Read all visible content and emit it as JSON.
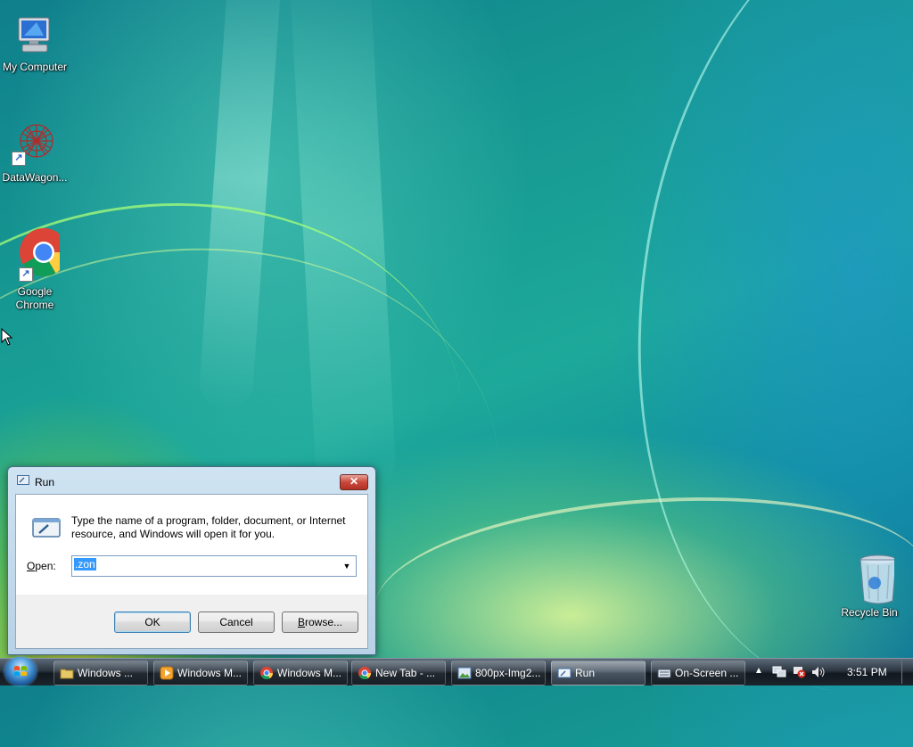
{
  "desktop": {
    "icons": [
      {
        "label": "My Computer",
        "icon": "computer-icon"
      },
      {
        "label": "DataWagon...",
        "icon": "datawagon-icon"
      },
      {
        "label_line1": "Google",
        "label_line2": "Chrome",
        "icon": "chrome-icon"
      },
      {
        "label": "Recycle Bin",
        "icon": "recycle-bin-icon"
      }
    ]
  },
  "run_dialog": {
    "title": "Run",
    "close_label": "✕",
    "description": "Type the name of a program, folder, document, or Internet resource, and Windows will open it for you.",
    "open_label_first": "O",
    "open_label_rest": "pen:",
    "open_value": ".zon",
    "ok_label": "OK",
    "cancel_label": "Cancel",
    "browse_label_first": "B",
    "browse_label_rest": "rowse..."
  },
  "taskbar": {
    "buttons": [
      {
        "label": "Windows ...",
        "icon": "folder-icon"
      },
      {
        "label": "Windows M...",
        "icon": "media-player-icon"
      },
      {
        "label": "Windows M...",
        "icon": "chrome-icon"
      },
      {
        "label": "New Tab - ...",
        "icon": "chrome-icon"
      },
      {
        "label": "800px-Img2...",
        "icon": "image-viewer-icon"
      },
      {
        "label": "Run",
        "icon": "run-icon"
      },
      {
        "label": "On-Screen ...",
        "icon": "keyboard-icon"
      }
    ],
    "clock": "3:51 PM"
  },
  "colors": {
    "selection": "#3399ff",
    "close_button": "#c9463a",
    "dialog_frame": "#b7d1e6"
  }
}
